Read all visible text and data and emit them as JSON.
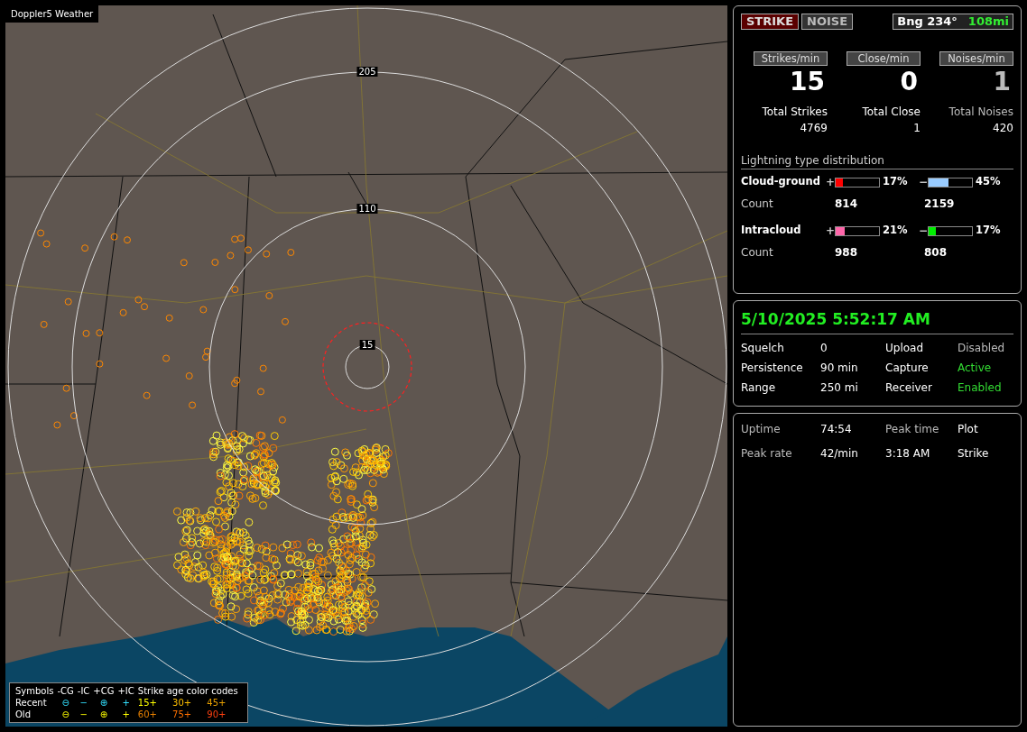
{
  "map": {
    "title": "Doppler5 Weather",
    "range_labels": [
      "205",
      "110",
      "15"
    ],
    "legend": {
      "header": [
        "Symbols",
        "-CG",
        "-IC",
        "+CG",
        "+IC",
        "Strike age color codes"
      ],
      "rows": [
        {
          "label": "Recent",
          "symbols": [
            "⊖",
            "−",
            "⊕",
            "+"
          ],
          "kind": "recent",
          "ages": [
            {
              "text": "15+",
              "color": "#ffff00"
            },
            {
              "text": "30+",
              "color": "#ffc000"
            },
            {
              "text": "45+",
              "color": "#e8a000"
            }
          ]
        },
        {
          "label": "Old",
          "symbols": [
            "⊖",
            "−",
            "⊕",
            "+"
          ],
          "kind": "old",
          "ages": [
            {
              "text": "60+",
              "color": "#e88000"
            },
            {
              "text": "75+",
              "color": "#ff7000"
            },
            {
              "text": "90+",
              "color": "#ff4010"
            }
          ]
        }
      ]
    }
  },
  "mode_buttons": [
    {
      "label": "STRIKE",
      "selected": true
    },
    {
      "label": "NOISE",
      "selected": false
    }
  ],
  "bearing": {
    "label": "Bng 234°",
    "distance": "108mi"
  },
  "rates": [
    {
      "label": "Strikes/min",
      "value": "15",
      "total_label": "Total Strikes",
      "total": "4769",
      "muted": false
    },
    {
      "label": "Close/min",
      "value": "0",
      "total_label": "Total Close",
      "total": "1",
      "muted": false
    },
    {
      "label": "Noises/min",
      "value": "1",
      "total_label": "Total Noises",
      "total": "420",
      "muted": true
    }
  ],
  "distribution": {
    "title": "Lightning type distribution",
    "rows": [
      {
        "label": "Cloud-ground",
        "count_label": "Count",
        "parts": [
          {
            "sign": "+",
            "level": 0.17,
            "percent": "17%",
            "color": "#ff0000",
            "count": "814"
          },
          {
            "sign": "−",
            "level": 0.45,
            "percent": "45%",
            "color": "#99ccff",
            "count": "2159"
          }
        ]
      },
      {
        "label": "Intracloud",
        "count_label": "Count",
        "parts": [
          {
            "sign": "+",
            "level": 0.21,
            "percent": "21%",
            "color": "#ff66aa",
            "count": "988"
          },
          {
            "sign": "−",
            "level": 0.17,
            "percent": "17%",
            "color": "#00ee00",
            "count": "808"
          }
        ]
      }
    ]
  },
  "status": {
    "datetime": "5/10/2025 5:52:17 AM",
    "items": [
      {
        "label": "Squelch",
        "value": "0",
        "color": "#ffffff"
      },
      {
        "label": "Upload",
        "value": "Disabled",
        "color": "#bbbbbb"
      },
      {
        "label": "Persistence",
        "value": "90 min",
        "color": "#ffffff"
      },
      {
        "label": "Capture",
        "value": "Active",
        "color": "#33dd33"
      },
      {
        "label": "Range",
        "value": "250 mi",
        "color": "#ffffff"
      },
      {
        "label": "Receiver",
        "value": "Enabled",
        "color": "#33dd33"
      }
    ]
  },
  "stats": {
    "rows": [
      [
        {
          "text": "Uptime",
          "kind": "label"
        },
        {
          "text": "74:54",
          "kind": "value"
        },
        {
          "text": "Peak time",
          "kind": "label"
        },
        {
          "text": "Plot",
          "kind": "value"
        }
      ],
      [
        {
          "text": "Peak rate",
          "kind": "label"
        },
        {
          "text": "42/min",
          "kind": "value"
        },
        {
          "text": "3:18 AM",
          "kind": "value"
        },
        {
          "text": "Strike",
          "kind": "value"
        }
      ]
    ]
  }
}
